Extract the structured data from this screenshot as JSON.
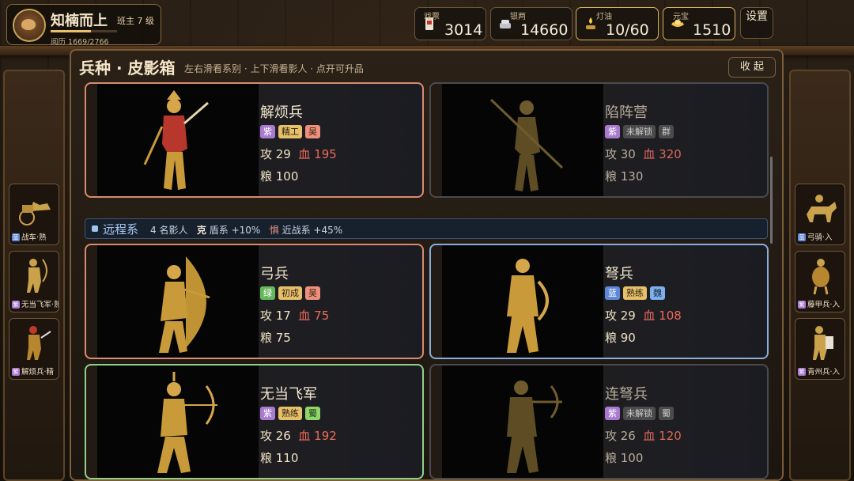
{
  "player": {
    "name": "知楠而上",
    "rank": "班主 7 级",
    "exp": "阅历 1669/2766",
    "exp_fraction": 0.603
  },
  "resources": [
    {
      "label": "戏票",
      "value": "3014",
      "icon": "ticket-icon"
    },
    {
      "label": "银两",
      "value": "14660",
      "icon": "silver-icon"
    },
    {
      "label": "灯油",
      "value": "10/60",
      "icon": "lamp-icon"
    },
    {
      "label": "元宝",
      "value": "1510",
      "icon": "ingot-icon"
    }
  ],
  "settings_label": "设置",
  "panel": {
    "title": "兵种 · 皮影箱",
    "subtitle": "左右滑看系别 · 上下滑看影人 · 点开可升品",
    "close_label": "收 起"
  },
  "left_side": [
    {
      "q": "蓝",
      "label": "战车·熟"
    },
    {
      "q": "紫",
      "label": "无当飞军·熟"
    },
    {
      "q": "紫",
      "label": "解烦兵·精"
    }
  ],
  "right_side": [
    {
      "q": "蓝",
      "label": "弓骑·入"
    },
    {
      "q": "紫",
      "label": "藤甲兵·入"
    },
    {
      "q": "紫",
      "label": "青州兵·入"
    }
  ],
  "cards": [
    {
      "name": "解烦兵",
      "q": "紫",
      "grade": "精工",
      "faction": "吴",
      "atk": "攻 29",
      "hp": "血 195",
      "food": "粮 100"
    },
    {
      "name": "陷阵营",
      "q": "紫",
      "grade": "未解锁",
      "faction": "群",
      "atk": "攻 30",
      "hp": "血 320",
      "food": "粮 130"
    },
    {
      "name": "弓兵",
      "q": "绿",
      "grade": "初成",
      "faction": "吴",
      "atk": "攻 17",
      "hp": "血 75",
      "food": "粮 75"
    },
    {
      "name": "弩兵",
      "q": "蓝",
      "grade": "熟练",
      "faction": "魏",
      "atk": "攻 29",
      "hp": "血 108",
      "food": "粮 90"
    },
    {
      "name": "无当飞军",
      "q": "紫",
      "grade": "熟练",
      "faction": "蜀",
      "atk": "攻 26",
      "hp": "血 192",
      "food": "粮 110"
    },
    {
      "name": "连弩兵",
      "q": "紫",
      "grade": "未解锁",
      "faction": "蜀",
      "atk": "攻 26",
      "hp": "血 120",
      "food": "粮 100"
    }
  ],
  "series": {
    "name": "远程系",
    "count": "4 名影人",
    "counter_label": "克",
    "counter_value": "盾系 +10%",
    "fear_label": "惧",
    "fear_value": "近战系 +45%"
  },
  "colors": {
    "purple": "#a87ad0",
    "green": "#66b95a",
    "blue": "#5f88d8",
    "tag_gold": "#e6c06a",
    "wu": "#f08f7a",
    "wei": "#7fb0ee",
    "shu": "#8fd66a",
    "locked": "#8a8a8a",
    "card_border_purple": "#d98a72",
    "card_border_blue": "#88aee0",
    "card_border_green": "#8fd08a"
  }
}
